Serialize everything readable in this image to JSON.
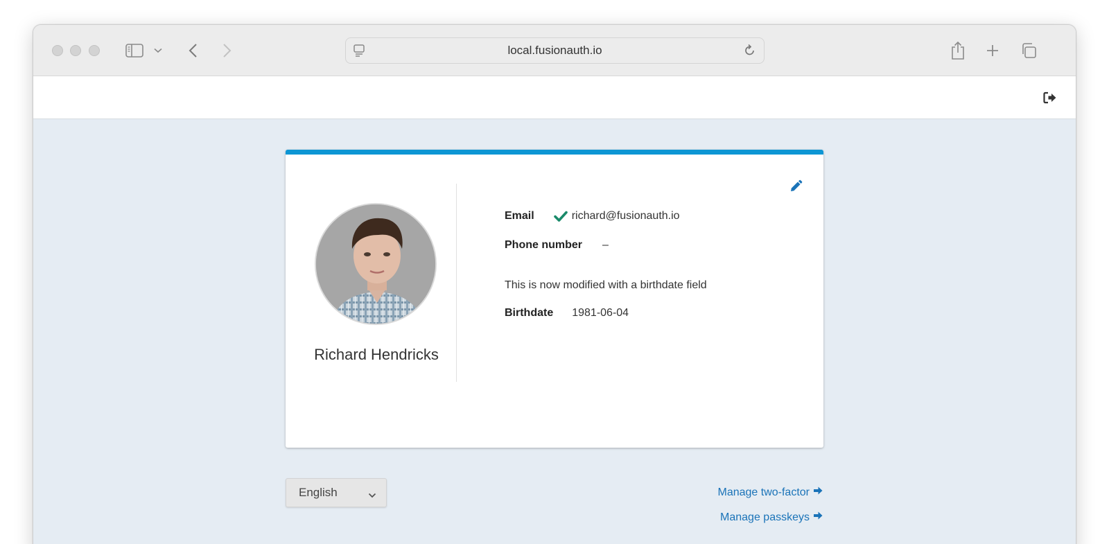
{
  "browser": {
    "url": "local.fusionauth.io"
  },
  "profile": {
    "name": "Richard Hendricks",
    "email_label": "Email",
    "email": "richard@fusionauth.io",
    "phone_label": "Phone number",
    "phone": "–",
    "note": "This is now modified with a birthdate field",
    "birthdate_label": "Birthdate",
    "birthdate": "1981-06-04"
  },
  "footer": {
    "language": "English",
    "manage_two_factor": "Manage two-factor",
    "manage_passkeys": "Manage passkeys"
  },
  "colors": {
    "accent": "#0d96d4",
    "link": "#1a73b8",
    "verified": "#1a8a6a",
    "background": "#e5ecf3"
  }
}
